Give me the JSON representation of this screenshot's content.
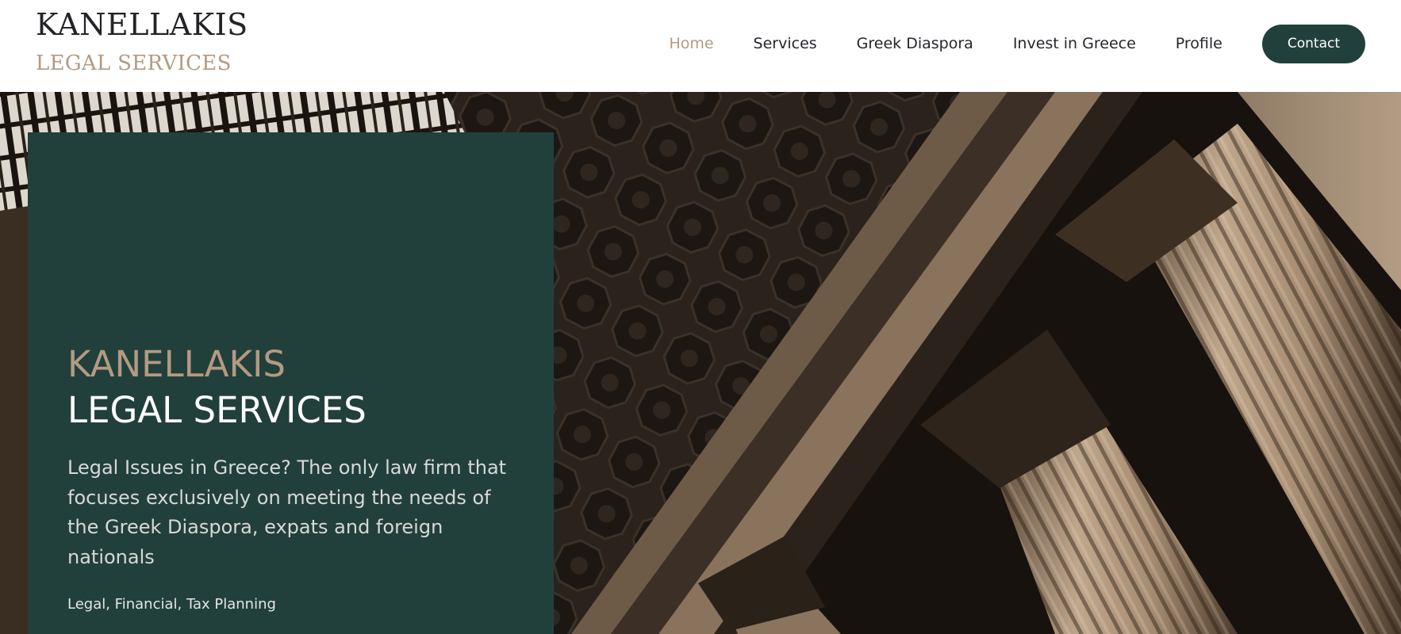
{
  "header": {
    "logo_line1": "KANELLAKIS",
    "logo_line2": "LEGAL SERVICES",
    "nav": {
      "home": "Home",
      "services": "Services",
      "greek_diaspora": "Greek Diaspora",
      "invest_in_greece": "Invest in Greece",
      "profile": "Profile",
      "contact": "Contact"
    }
  },
  "hero": {
    "title_line1": "KANELLAKIS",
    "title_line2": "LEGAL SERVICES",
    "description": "Legal Issues in Greece? The only law firm that focuses exclusively on meeting the needs of the Greek Diaspora, expats and foreign nationals",
    "tags": "Legal, Financial, Tax Planning"
  },
  "colors": {
    "brand_green": "#22403b",
    "accent_tan": "#b39a82",
    "text_dark": "#24262b"
  }
}
